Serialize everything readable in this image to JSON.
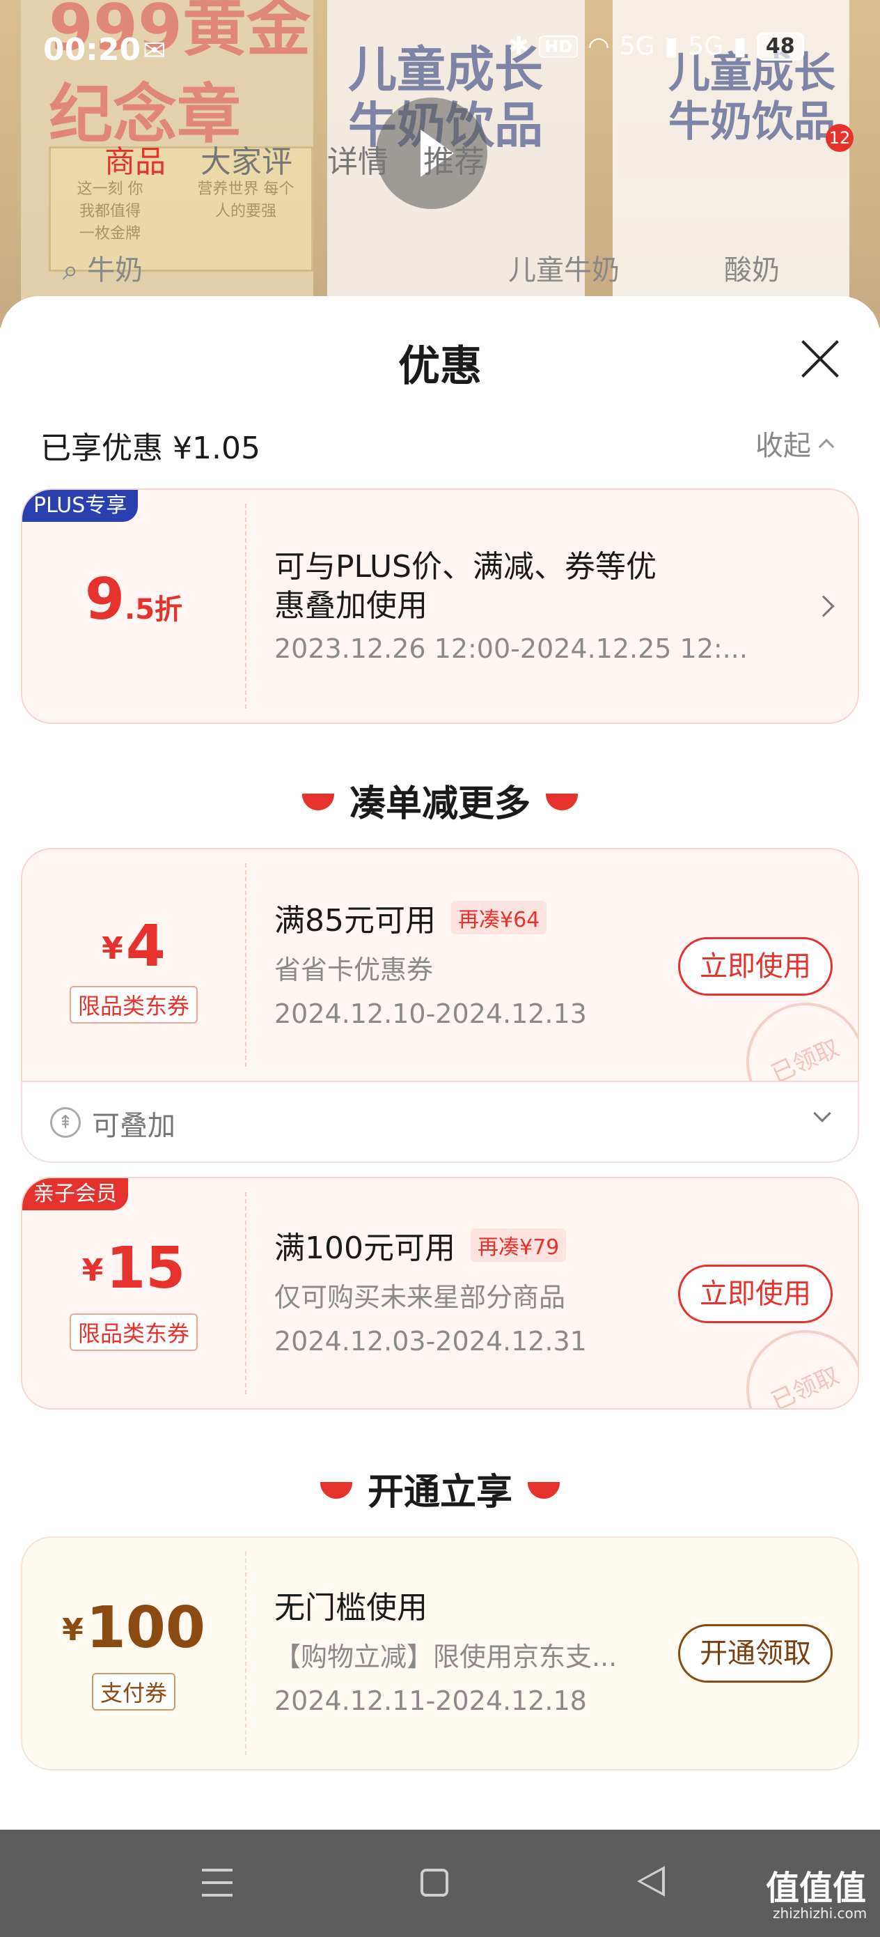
{
  "status_bar": {
    "time": "00:20",
    "wechat_icon": "wechat-icon",
    "hd_label": "HD",
    "net_5g_1": "5G",
    "net_5g_2": "5G",
    "battery": "48"
  },
  "background": {
    "promo_title_1": "999黄金",
    "promo_title_2": "纪念章",
    "plaque_left": "这一刻 你我都值得 一枚金牌",
    "plaque_right": "营养世界 每个人的要强",
    "product_name_mid": "儿童成长 牛奶饮品",
    "product_name_right": "儿童成长 牛奶饮品",
    "cart_badge": "12",
    "tabs": [
      "商品",
      "大家评",
      "详情",
      "推荐"
    ],
    "search_terms": [
      "牛奶",
      "儿童牛奶",
      "酸奶"
    ]
  },
  "sheet": {
    "title": "优惠",
    "enjoyed_label": "已享优惠 ¥1.05",
    "collapse_label": "收起"
  },
  "plus_card": {
    "tag": "PLUS专享",
    "discount_main": "9",
    "discount_sub": ".5折",
    "desc_line1": "可与PLUS价、满减、券等优",
    "desc_line2": "惠叠加使用",
    "period": "2023.12.26 12:00-2024.12.25 12:..."
  },
  "section_more": {
    "title": "凑单减更多"
  },
  "coupons": [
    {
      "currency": "¥",
      "amount": "4",
      "kind": "限品类东券",
      "condition": "满85元可用",
      "extra": "再凑¥64",
      "desc": "省省卡优惠券",
      "period": "2024.12.10-2024.12.13",
      "button": "立即使用",
      "stamp": "已领取"
    },
    {
      "tag": "亲子会员",
      "currency": "¥",
      "amount": "15",
      "kind": "限品类东券",
      "condition": "满100元可用",
      "extra": "再凑¥79",
      "desc": "仅可购买未来星部分商品",
      "period": "2024.12.03-2024.12.31",
      "button": "立即使用",
      "stamp": "已领取"
    }
  ],
  "stackable": {
    "label": "可叠加"
  },
  "section_open": {
    "title": "开通立享"
  },
  "pay_coupon": {
    "currency": "¥",
    "amount": "100",
    "kind": "支付券",
    "condition": "无门槛使用",
    "desc": "【购物立减】限使用京东支...",
    "period": "2024.12.11-2024.12.18",
    "button": "开通领取"
  },
  "watermark": {
    "text": "值值值",
    "sub": "zhizhizhi.com"
  },
  "colors": {
    "accent": "#e5322d",
    "gold_brown": "#8a4a12",
    "plus_tag": "#2a3fb0"
  }
}
